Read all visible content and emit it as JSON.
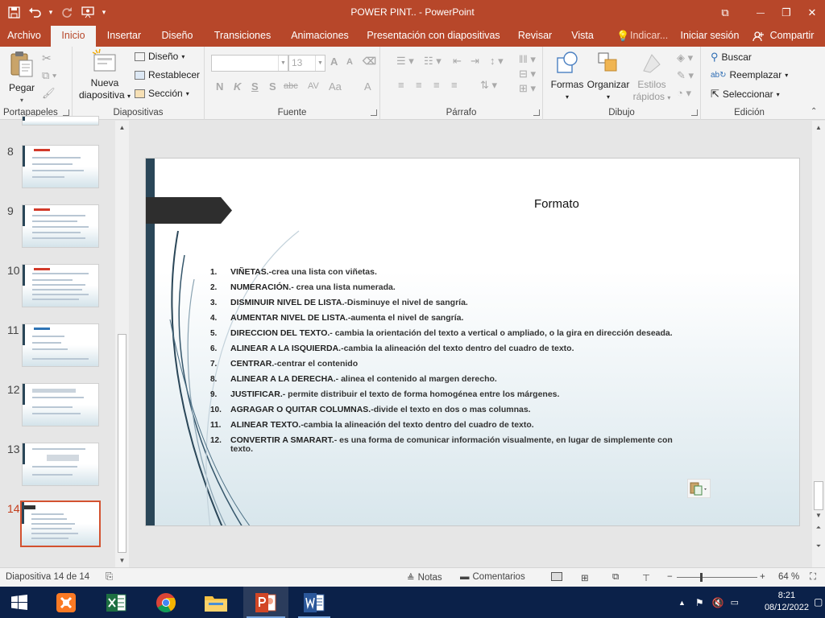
{
  "window": {
    "title": "POWER PINT.. - PowerPoint",
    "minimize": "—",
    "restore": "❐",
    "close": "✕",
    "ribbon_display": "⧉"
  },
  "tabs": [
    {
      "label": "Archivo"
    },
    {
      "label": "Inicio"
    },
    {
      "label": "Insertar"
    },
    {
      "label": "Diseño"
    },
    {
      "label": "Transiciones"
    },
    {
      "label": "Animaciones"
    },
    {
      "label": "Presentación con diapositivas"
    },
    {
      "label": "Revisar"
    },
    {
      "label": "Vista"
    },
    {
      "label": "Indicar..."
    },
    {
      "label": "Iniciar sesión"
    },
    {
      "label": "Compartir"
    }
  ],
  "ribbon": {
    "clipboard": {
      "label": "Portapapeles",
      "paste": "Pegar"
    },
    "slides": {
      "label": "Diapositivas",
      "new_slide_1": "Nueva",
      "new_slide_2": "diapositiva",
      "layout": "Diseño",
      "reset": "Restablecer",
      "section": "Sección"
    },
    "font": {
      "label": "Fuente",
      "size": "13",
      "bold": "N",
      "italic": "K",
      "underline": "S",
      "shadow": "S",
      "strike": "abc",
      "spacing": "AV",
      "case": "Aa",
      "color": "A",
      "grow": "A",
      "shrink": "A"
    },
    "paragraph": {
      "label": "Párrafo"
    },
    "drawing": {
      "label": "Dibujo",
      "shapes": "Formas",
      "arrange": "Organizar",
      "styles_1": "Estilos",
      "styles_2": "rápidos"
    },
    "editing": {
      "label": "Edición",
      "find": "Buscar",
      "replace": "Reemplazar",
      "select": "Seleccionar"
    }
  },
  "thumbnails": [
    {
      "num": "8",
      "accent": "red"
    },
    {
      "num": "9",
      "accent": "red"
    },
    {
      "num": "10",
      "accent": "red"
    },
    {
      "num": "11",
      "accent": "blue"
    },
    {
      "num": "12",
      "accent": "none"
    },
    {
      "num": "13",
      "accent": "none"
    },
    {
      "num": "14",
      "accent": "none",
      "selected": true
    }
  ],
  "slide": {
    "title": "Formato",
    "items": [
      {
        "n": "1.",
        "term": "VIÑETAS.",
        "desc": "-crea una lista con viñetas."
      },
      {
        "n": "2.",
        "term": "NUMERACIÓN.",
        "desc": "- crea una lista numerada."
      },
      {
        "n": "3.",
        "term": "DISMINUIR NIVEL DE LISTA.",
        "desc": "-Disminuye el nivel de sangría."
      },
      {
        "n": "4.",
        "term": "AUMENTAR NIVEL DE LISTA.",
        "desc": "-aumenta el nivel de sangría."
      },
      {
        "n": "5.",
        "term": "DIRECCION DEL TEXTO.",
        "desc": "- cambia la orientación del texto a vertical o ampliado, o la gira en dirección deseada."
      },
      {
        "n": "6.",
        "term": "ALINEAR A LA ISQUIERDA.",
        "desc": "-cambia la alineación del texto dentro del cuadro de texto."
      },
      {
        "n": "7.",
        "term": "CENTRAR.",
        "desc": "-centrar el contenido"
      },
      {
        "n": "8.",
        "term": "ALINEAR A LA DERECHA.",
        "desc": "- alinea el contenido al margen  derecho."
      },
      {
        "n": "9.",
        "term": "JUSTIFICAR.",
        "desc": "- permite distribuir el texto de forma homogénea entre los márgenes."
      },
      {
        "n": "10.",
        "term": "AGRAGAR O QUITAR COLUMNAS.",
        "desc": "-divide el texto en dos o mas columnas."
      },
      {
        "n": "11.",
        "term": "ALINEAR TEXTO.",
        "desc": "-cambia la alineación del texto dentro del cuadro de texto."
      },
      {
        "n": "12.",
        "term": "CONVERTIR A SMARART.",
        "desc": "- es una forma de comunicar información visualmente, en lugar de simplemente con  texto."
      }
    ]
  },
  "status": {
    "slide_count": "Diapositiva 14 de 14",
    "notes": "Notas",
    "comments": "Comentarios",
    "zoom": "64 %",
    "zoom_level": 0.64,
    "zoom_minus": "−",
    "zoom_plus": "+"
  },
  "taskbar": {
    "time": "8:21",
    "date": "08/12/2022"
  },
  "colors": {
    "accent": "#b7472a",
    "taskbar": "#0b2149",
    "slide_bar": "#2a4658"
  }
}
